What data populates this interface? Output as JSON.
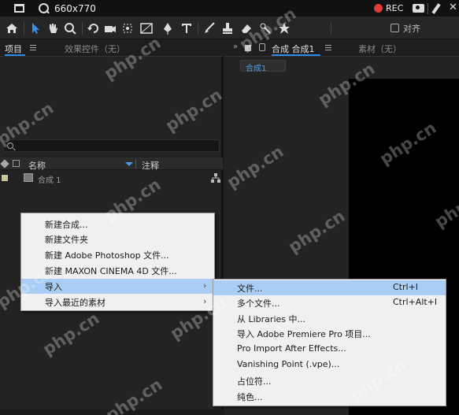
{
  "capture_bar": {
    "dimensions": "660x770",
    "rec_label": "REC"
  },
  "toolbar": {
    "align_label": "对齐"
  },
  "project_panel": {
    "tab_project": "项目",
    "tab_effects": "效果控件（无）",
    "col_name": "名称",
    "col_note": "注释",
    "row_name": "合成 1"
  },
  "comp_panel": {
    "tab_comp": "合成 合成1",
    "tab_footage": "素材（无）",
    "comp_chip": "合成1"
  },
  "context_menu": {
    "items": [
      {
        "label": "新建合成..."
      },
      {
        "label": "新建文件夹"
      },
      {
        "label": "新建 Adobe Photoshop 文件..."
      },
      {
        "label": "新建 MAXON CINEMA 4D 文件..."
      },
      {
        "label": "导入",
        "submenu": true,
        "highlighted": true
      },
      {
        "label": "导入最近的素材",
        "submenu": true
      }
    ],
    "chevron": "›"
  },
  "import_submenu": {
    "items": [
      {
        "label": "文件...",
        "shortcut": "Ctrl+I",
        "highlighted": true
      },
      {
        "label": "多个文件...",
        "shortcut": "Ctrl+Alt+I"
      },
      {
        "label": "从 Libraries 中..."
      },
      {
        "label": "导入 Adobe Premiere Pro 项目..."
      },
      {
        "label": "Pro Import After Effects..."
      },
      {
        "label": "Vanishing Point (.vpe)..."
      },
      {
        "label": "占位符..."
      },
      {
        "label": "纯色..."
      }
    ]
  },
  "watermark": "php.cn",
  "colors": {
    "highlight": "#a9cdf4",
    "accent_blue": "#2d8ceb",
    "rec_red": "#e23b3b"
  }
}
